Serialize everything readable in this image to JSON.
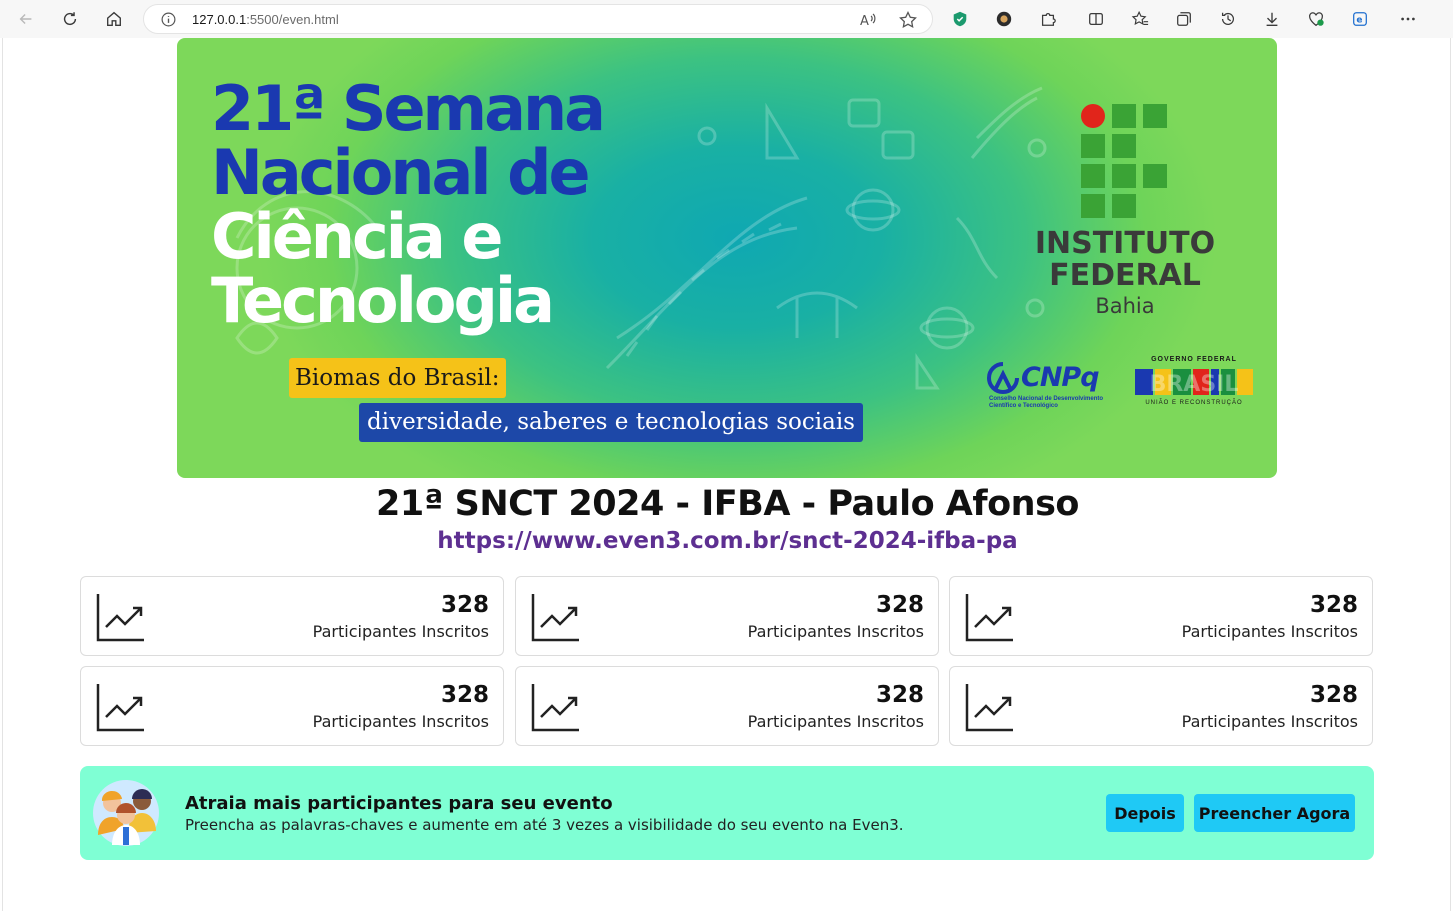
{
  "browser": {
    "url_host": "127.0.0.1",
    "url_rest": ":5500/even.html"
  },
  "banner": {
    "line1": "21ª Semana",
    "line2": "Nacional de",
    "line3": "Ciência e",
    "line4": "Tecnologia",
    "tag1": "Biomas do Brasil:",
    "tag2": "diversidade, saberes e tecnologias sociais",
    "institute_line1": "INSTITUTO",
    "institute_line2": "FEDERAL",
    "institute_line3": "Bahia",
    "cnpq_name": "CNPq",
    "cnpq_sub": "Conselho Nacional de Desenvolvimento Científico e Tecnológico",
    "gov_top": "GOVERNO FEDERAL",
    "gov_word": "BRASIL",
    "gov_sub": "UNIÃO E RECONSTRUÇÃO"
  },
  "event": {
    "title": "21ª SNCT 2024 - IFBA - Paulo Afonso",
    "url": "https://www.even3.com.br/snct-2024-ifba-pa"
  },
  "stats": [
    {
      "value": "328",
      "label": "Participantes Inscritos"
    },
    {
      "value": "328",
      "label": "Participantes Inscritos"
    },
    {
      "value": "328",
      "label": "Participantes Inscritos"
    },
    {
      "value": "328",
      "label": "Participantes Inscritos"
    },
    {
      "value": "328",
      "label": "Participantes Inscritos"
    },
    {
      "value": "328",
      "label": "Participantes Inscritos"
    }
  ],
  "promo": {
    "title": "Atraia mais participantes para seu evento",
    "text": "Preencha as palavras-chaves e aumente em até 3 vezes a visibilidade do seu evento na Even3.",
    "later_label": "Depois",
    "fill_label": "Preencher Agora"
  },
  "colors": {
    "brand_blue": "#1a39b0",
    "url_purple": "#5d2f91",
    "promo_bg": "#7fffd4",
    "button_bg": "#1fc9f5",
    "if_green": "#3aa335",
    "if_red": "#e1251b"
  },
  "icons": {
    "stat": "trending-up-icon",
    "promo": "people-group-icon"
  }
}
